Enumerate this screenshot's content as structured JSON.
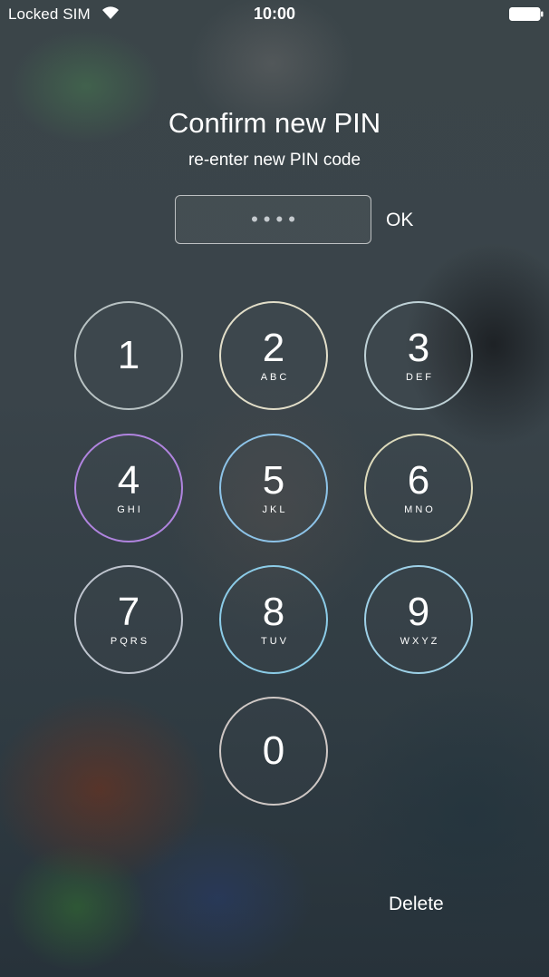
{
  "status_bar": {
    "carrier": "Locked SIM",
    "time": "10:00",
    "wifi_icon": "wifi-icon",
    "battery_icon": "battery-icon"
  },
  "header": {
    "title": "Confirm new PIN",
    "subtitle": "re-enter new PIN code"
  },
  "pin_entry": {
    "masked_value": "••••",
    "ok_label": "OK"
  },
  "keypad": {
    "keys": [
      {
        "digit": "1",
        "letters": ""
      },
      {
        "digit": "2",
        "letters": "ABC"
      },
      {
        "digit": "3",
        "letters": "DEF"
      },
      {
        "digit": "4",
        "letters": "GHI"
      },
      {
        "digit": "5",
        "letters": "JKL"
      },
      {
        "digit": "6",
        "letters": "MNO"
      },
      {
        "digit": "7",
        "letters": "PQRS"
      },
      {
        "digit": "8",
        "letters": "TUV"
      },
      {
        "digit": "9",
        "letters": "WXYZ"
      },
      {
        "digit": "0",
        "letters": ""
      }
    ]
  },
  "actions": {
    "delete_label": "Delete"
  }
}
